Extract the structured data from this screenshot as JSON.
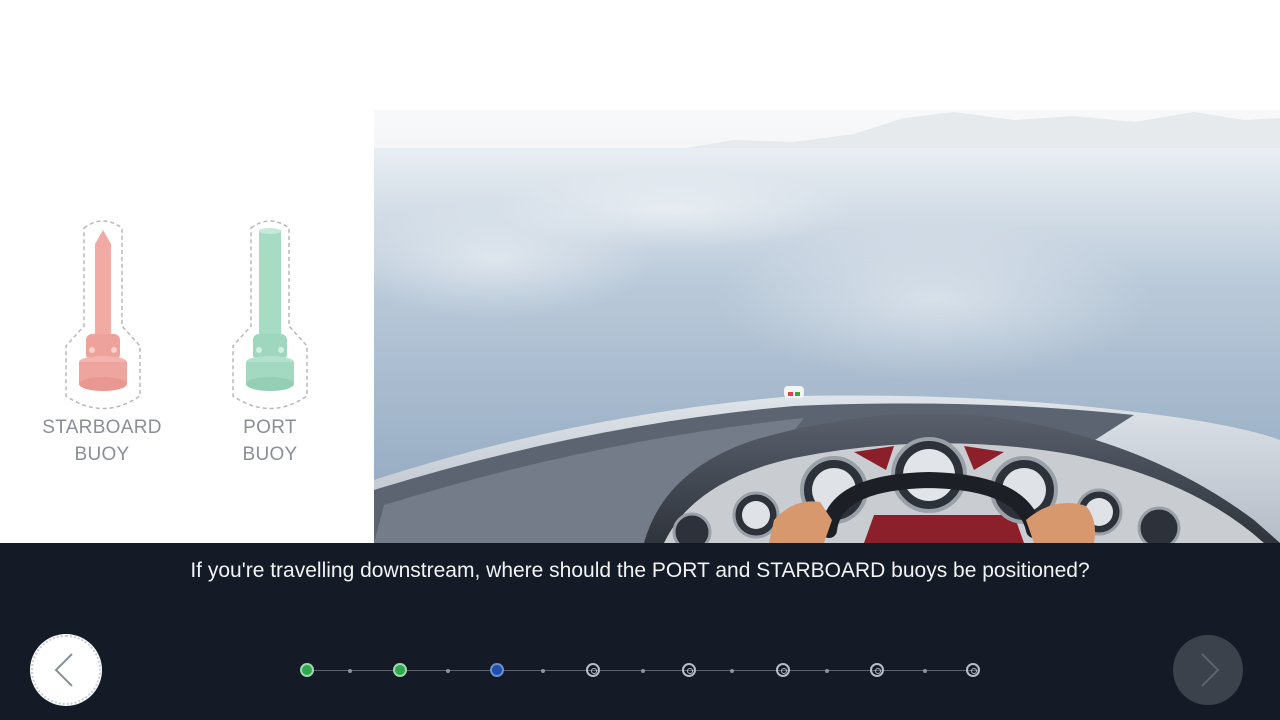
{
  "buoys": [
    {
      "label_line1": "STARBOARD",
      "label_line2": "BUOY",
      "color": "#f0a9a4"
    },
    {
      "label_line1": "PORT",
      "label_line2": "BUOY",
      "color": "#a9dcc6"
    }
  ],
  "question": "If you're travelling downstream, where should the PORT and STARBOARD buoys be positioned?",
  "progress": {
    "total_steps": 8,
    "completed_steps": 2,
    "current_step": 3
  },
  "colors": {
    "bar_bg": "#141b26",
    "done": "#2fa84f",
    "current": "#1f4fa8",
    "water": "#9db3c9"
  },
  "icons": {
    "prev": "chevron-left-icon",
    "next": "chevron-right-icon"
  }
}
